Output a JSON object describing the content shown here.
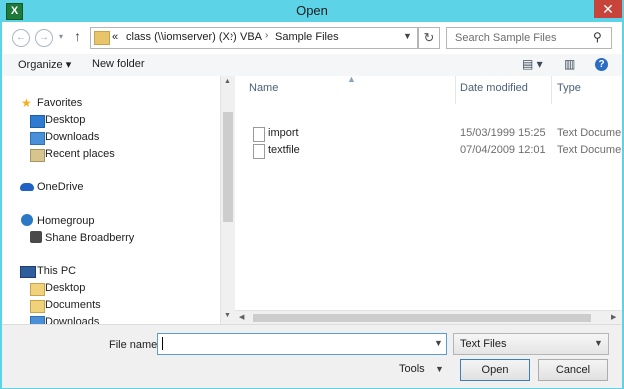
{
  "window": {
    "title": "Open",
    "app_icon": "X",
    "close_glyph": "✕"
  },
  "nav": {
    "back_icon": "←",
    "forward_icon": "→",
    "recent_icon": "▾",
    "up_icon": "↑",
    "address": {
      "prefix": "«",
      "crumbs": [
        "class (\\\\iomserver) (X:)",
        "VBA",
        "Sample Files"
      ],
      "sep": "›"
    },
    "refresh_icon": "↻",
    "search": {
      "placeholder": "Search Sample Files",
      "icon": "⚲"
    }
  },
  "toolbar": {
    "organize_label": "Organize ▾",
    "new_folder_label": "New folder",
    "views_icon": "▤ ▾",
    "pane_icon": "▥",
    "help_icon": "?"
  },
  "sidebar": {
    "favorites": {
      "label": "Favorites",
      "items": [
        "Desktop",
        "Downloads",
        "Recent places"
      ]
    },
    "onedrive": {
      "label": "OneDrive"
    },
    "homegroup": {
      "label": "Homegroup",
      "items": [
        "Shane Broadberry"
      ]
    },
    "thispc": {
      "label": "This PC",
      "items": [
        "Desktop",
        "Documents",
        "Downloads"
      ]
    }
  },
  "list": {
    "columns": [
      "Name",
      "Date modified",
      "Type"
    ],
    "files": [
      {
        "name": "import",
        "date": "15/03/1999 15:25",
        "type": "Text Document"
      },
      {
        "name": "textfile",
        "date": "07/04/2009 12:01",
        "type": "Text Document"
      }
    ]
  },
  "bottom": {
    "file_name_label": "File name:",
    "file_name_value": "",
    "file_type": "Text Files",
    "tools_label": "Tools",
    "open_label": "Open",
    "cancel_label": "Cancel"
  },
  "colors": {
    "titlebar": "#5cd3e6",
    "close": "#c7443a",
    "accent": "#3c7fb1"
  }
}
